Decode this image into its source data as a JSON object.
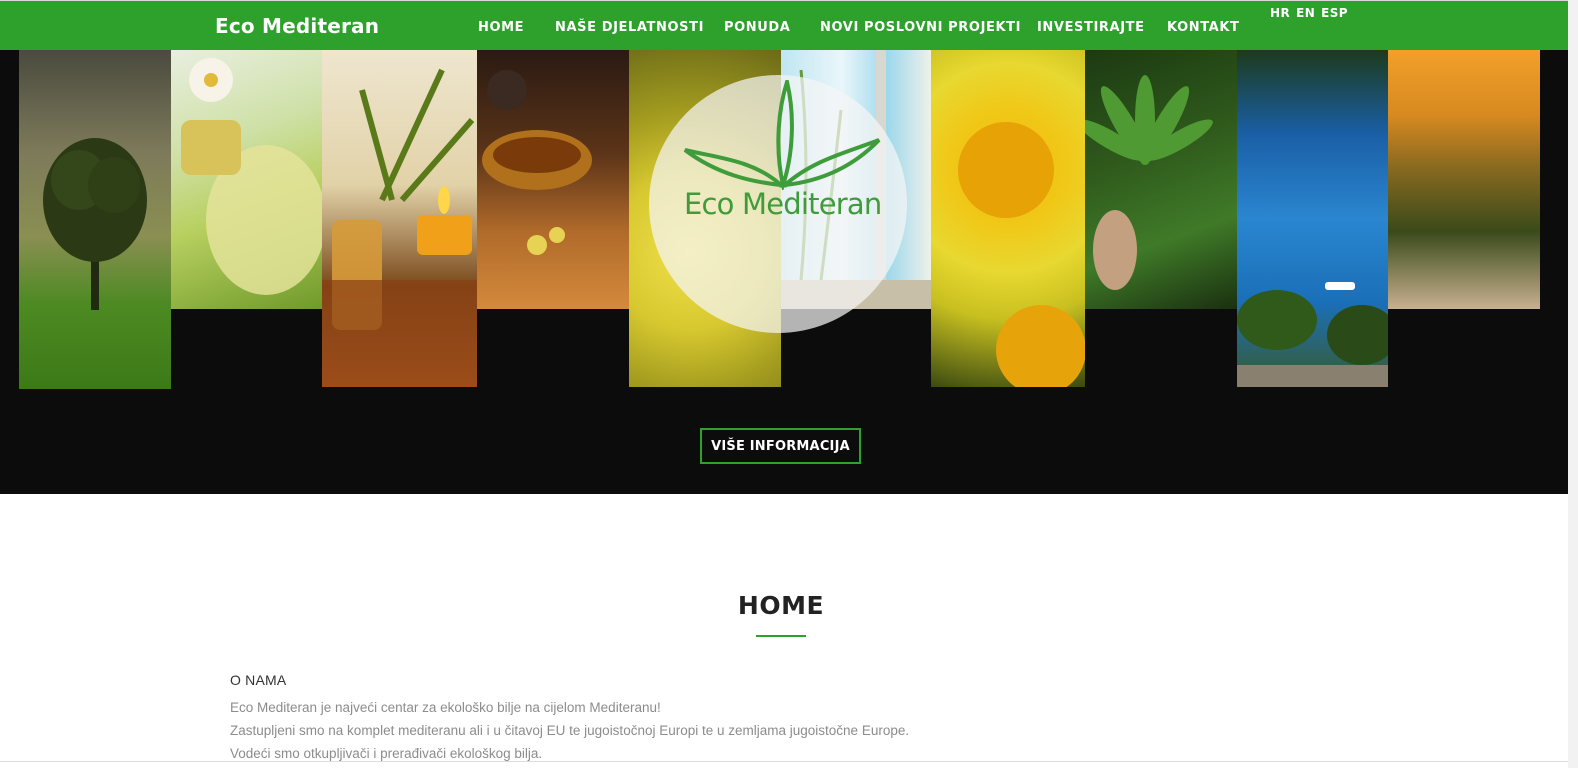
{
  "navbar": {
    "brand": "Eco Mediteran",
    "items": [
      {
        "label": "HOME"
      },
      {
        "label": "NAŠE DJELATNOSTI"
      },
      {
        "label": "PONUDA"
      },
      {
        "label": "NOVI POSLOVNI PROJEKTI"
      },
      {
        "label": "INVESTIRAJTE"
      },
      {
        "label": "KONTAKT"
      }
    ],
    "languages": [
      "HR",
      "EN",
      "ESP"
    ]
  },
  "hero": {
    "logo_text": "Eco Mediteran",
    "button_label": "VIŠE INFORMACIJA"
  },
  "section": {
    "title": "HOME",
    "subheading": "O NAMA",
    "paragraph_lines": [
      "Eco Mediteran je najveći centar za ekološko bilje na cijelom Mediteranu!",
      "Zastupljeni smo na komplet mediteranu ali i u čitavoj EU te jugoistočnoj Europi te u zemljama jugoistočne Europe.",
      "Vodeći smo otkupljivači i prerađivači ekološkog bilja."
    ]
  },
  "colors": {
    "brand_green": "#2ea12d",
    "hero_background": "#0c0c0c"
  }
}
